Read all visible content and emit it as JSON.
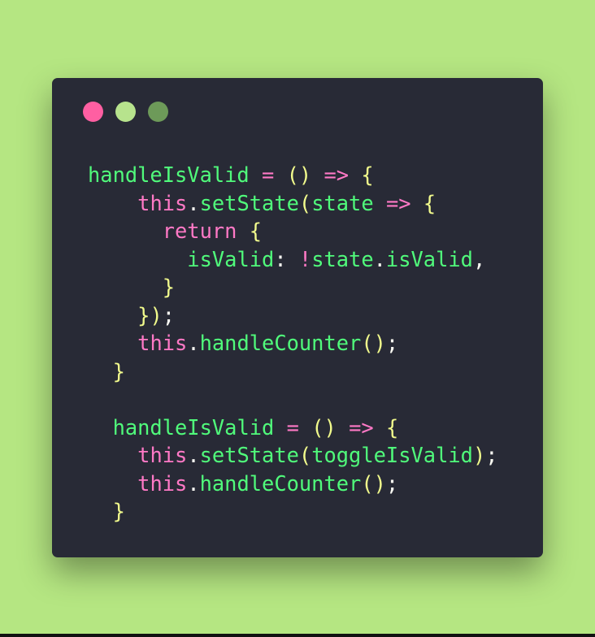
{
  "colors": {
    "background": "#b5e682",
    "window": "#282a36",
    "close_dot": "#ff5fa2",
    "minimize_dot": "#b7e38d",
    "maximize_dot": "#6d9a59",
    "plain": "#f8f8f2",
    "green": "#50fa7b",
    "pink": "#ff79c6",
    "yellow": "#f1fa8c",
    "cyan": "#8be9fd"
  },
  "window_controls": [
    {
      "name": "close",
      "color": "#ff5fa2"
    },
    {
      "name": "minimize",
      "color": "#b7e38d"
    },
    {
      "name": "maximize",
      "color": "#6d9a59"
    }
  ],
  "code_lines": [
    {
      "indent": "",
      "tokens": [
        {
          "text": "handleIsValid",
          "class": "green"
        },
        {
          "text": " ",
          "class": "plain"
        },
        {
          "text": "=",
          "class": "pink"
        },
        {
          "text": " ",
          "class": "plain"
        },
        {
          "text": "()",
          "class": "yellow"
        },
        {
          "text": " ",
          "class": "plain"
        },
        {
          "text": "=>",
          "class": "pink"
        },
        {
          "text": " ",
          "class": "plain"
        },
        {
          "text": "{",
          "class": "yellow"
        }
      ]
    },
    {
      "indent": "    ",
      "tokens": [
        {
          "text": "this",
          "class": "pink"
        },
        {
          "text": ".",
          "class": "plain"
        },
        {
          "text": "setState",
          "class": "green"
        },
        {
          "text": "(",
          "class": "yellow"
        },
        {
          "text": "state",
          "class": "green"
        },
        {
          "text": " ",
          "class": "plain"
        },
        {
          "text": "=>",
          "class": "pink"
        },
        {
          "text": " ",
          "class": "plain"
        },
        {
          "text": "{",
          "class": "yellow"
        }
      ]
    },
    {
      "indent": "      ",
      "tokens": [
        {
          "text": "return",
          "class": "pink"
        },
        {
          "text": " ",
          "class": "plain"
        },
        {
          "text": "{",
          "class": "yellow"
        }
      ]
    },
    {
      "indent": "        ",
      "tokens": [
        {
          "text": "isValid",
          "class": "green"
        },
        {
          "text": ": ",
          "class": "plain"
        },
        {
          "text": "!",
          "class": "pink"
        },
        {
          "text": "state",
          "class": "green"
        },
        {
          "text": ".",
          "class": "plain"
        },
        {
          "text": "isValid",
          "class": "green"
        },
        {
          "text": ",",
          "class": "plain"
        }
      ]
    },
    {
      "indent": "      ",
      "tokens": [
        {
          "text": "}",
          "class": "yellow"
        }
      ]
    },
    {
      "indent": "    ",
      "tokens": [
        {
          "text": "})",
          "class": "yellow"
        },
        {
          "text": ";",
          "class": "plain"
        }
      ]
    },
    {
      "indent": "    ",
      "tokens": [
        {
          "text": "this",
          "class": "pink"
        },
        {
          "text": ".",
          "class": "plain"
        },
        {
          "text": "handleCounter",
          "class": "green"
        },
        {
          "text": "()",
          "class": "yellow"
        },
        {
          "text": ";",
          "class": "plain"
        }
      ]
    },
    {
      "indent": "  ",
      "tokens": [
        {
          "text": "}",
          "class": "yellow"
        }
      ]
    },
    {
      "indent": "",
      "tokens": []
    },
    {
      "indent": "  ",
      "tokens": [
        {
          "text": "handleIsValid",
          "class": "green"
        },
        {
          "text": " ",
          "class": "plain"
        },
        {
          "text": "=",
          "class": "pink"
        },
        {
          "text": " ",
          "class": "plain"
        },
        {
          "text": "()",
          "class": "yellow"
        },
        {
          "text": " ",
          "class": "plain"
        },
        {
          "text": "=>",
          "class": "pink"
        },
        {
          "text": " ",
          "class": "plain"
        },
        {
          "text": "{",
          "class": "yellow"
        }
      ]
    },
    {
      "indent": "    ",
      "tokens": [
        {
          "text": "this",
          "class": "pink"
        },
        {
          "text": ".",
          "class": "plain"
        },
        {
          "text": "setState",
          "class": "green"
        },
        {
          "text": "(",
          "class": "yellow"
        },
        {
          "text": "toggleIsValid",
          "class": "green"
        },
        {
          "text": ")",
          "class": "yellow"
        },
        {
          "text": ";",
          "class": "plain"
        }
      ]
    },
    {
      "indent": "    ",
      "tokens": [
        {
          "text": "this",
          "class": "pink"
        },
        {
          "text": ".",
          "class": "plain"
        },
        {
          "text": "handleCounter",
          "class": "green"
        },
        {
          "text": "()",
          "class": "yellow"
        },
        {
          "text": ";",
          "class": "plain"
        }
      ]
    },
    {
      "indent": "  ",
      "tokens": [
        {
          "text": "}",
          "class": "yellow"
        }
      ]
    }
  ]
}
